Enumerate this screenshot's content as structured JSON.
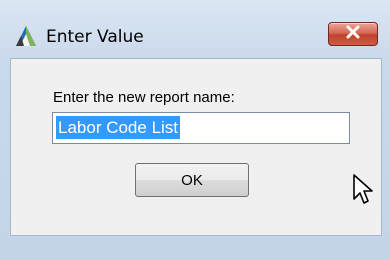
{
  "dialog": {
    "title": "Enter Value",
    "icons": {
      "app": "app-triangle-icon",
      "close": "close-icon"
    },
    "close_button_color": "#c8452f"
  },
  "form": {
    "prompt": "Enter the new report name:",
    "input_value": "Labor Code List",
    "input_selected": true
  },
  "buttons": {
    "ok": "OK"
  },
  "colors": {
    "selection": "#3399ff",
    "window_frame": "#cad9eb"
  }
}
